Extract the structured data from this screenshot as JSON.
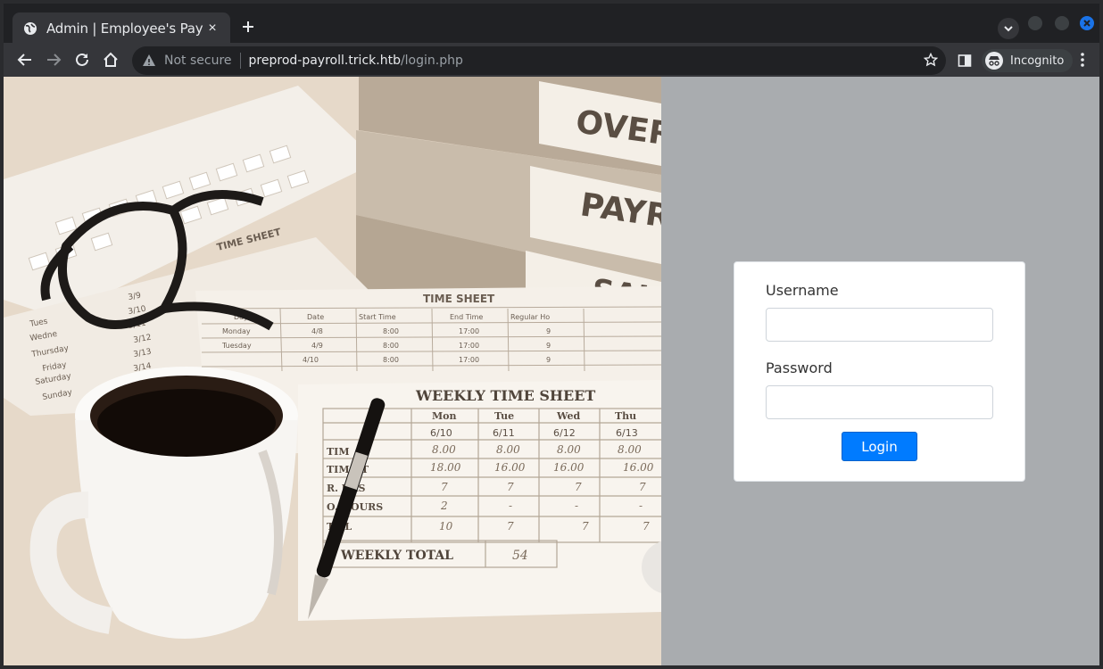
{
  "browser": {
    "tab_title": "Admin | Employee's Payro",
    "tab_close": "×",
    "new_tab": "+",
    "security_label": "Not secure",
    "url_host": "preprod-payroll.trick.htb",
    "url_path": "/login.php",
    "profile_label": "Incognito"
  },
  "photo": {
    "binders": [
      "OVER",
      "PAYR",
      "SALA"
    ],
    "timesheet_title": "TIME SHEET",
    "timesheet_back_title": "TIME SHEET",
    "back_headers": [
      "Day",
      "Date",
      "Start Time",
      "End Time",
      "Regular Ho"
    ],
    "back_rows": [
      [
        "Monday",
        "4/8",
        "8:00",
        "17:00",
        "9"
      ],
      [
        "Tuesday",
        "4/9",
        "8:00",
        "17:00",
        "9"
      ],
      [
        "",
        "4/10",
        "8:00",
        "17:00",
        "9"
      ]
    ],
    "side_days": [
      "Tues",
      "Wedne",
      "Thursday",
      "Friday",
      "Saturday",
      "Sunday"
    ],
    "side_dates": [
      "3/9",
      "3/10",
      "3/11",
      "3/12",
      "3/13",
      "3/14"
    ],
    "weekly_title": "WEEKLY TIME SHEET",
    "weekly_days": [
      "Mon",
      "Tue",
      "Wed",
      "Thu"
    ],
    "weekly_dates": [
      "6/10",
      "6/11",
      "6/12",
      "6/13"
    ],
    "weekly_in": [
      "8.00",
      "8.00",
      "8.00",
      "8.00"
    ],
    "weekly_out": [
      "18.00",
      "16.00",
      "16.00",
      "16.00"
    ],
    "weekly_reg": [
      "7",
      "7",
      "7",
      "7"
    ],
    "weekly_ot": [
      "2",
      "-",
      "-",
      "-"
    ],
    "weekly_total": [
      "10",
      "7",
      "7",
      "7"
    ],
    "row_labels": [
      "TIM",
      "TIM  UT",
      "R.  URS",
      "O.  HOURS",
      "T  AL"
    ],
    "weekly_total_label": "WEEKLY TOTAL",
    "weekly_total_value": "54"
  },
  "login": {
    "username_label": "Username",
    "password_label": "Password",
    "button_label": "Login"
  }
}
